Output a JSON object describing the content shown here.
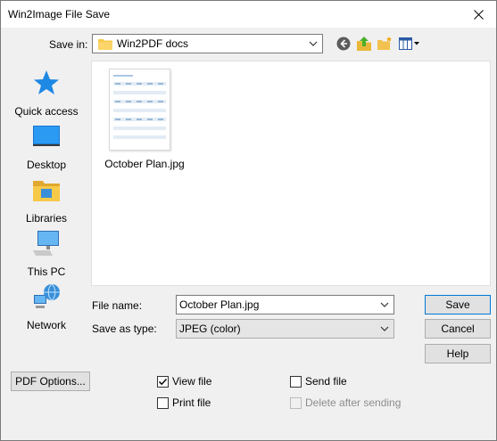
{
  "window": {
    "title": "Win2Image File Save"
  },
  "save_in": {
    "label": "Save in:",
    "value": "Win2PDF docs"
  },
  "toolbar": {
    "back_icon": "back-arrow-icon",
    "up_icon": "up-folder-icon",
    "new_folder_icon": "new-folder-icon",
    "view_menu_icon": "view-menu-icon"
  },
  "places": [
    {
      "label": "Quick access",
      "icon": "star-icon"
    },
    {
      "label": "Desktop",
      "icon": "desktop-icon"
    },
    {
      "label": "Libraries",
      "icon": "libraries-icon"
    },
    {
      "label": "This PC",
      "icon": "computer-icon"
    },
    {
      "label": "Network",
      "icon": "network-icon"
    }
  ],
  "files": [
    {
      "name": "October Plan.jpg"
    }
  ],
  "form": {
    "file_name_label": "File name:",
    "file_name_value": "October Plan.jpg",
    "save_type_label": "Save as type:",
    "save_type_value": "JPEG (color)"
  },
  "buttons": {
    "save": "Save",
    "cancel": "Cancel",
    "help": "Help",
    "pdf_options": "PDF Options..."
  },
  "options": {
    "view_file": {
      "label": "View file",
      "checked": true
    },
    "print_file": {
      "label": "Print file",
      "checked": false
    },
    "send_file": {
      "label": "Send file",
      "checked": false
    },
    "delete_after": {
      "label": "Delete after sending",
      "checked": false,
      "disabled": true
    }
  },
  "colors": {
    "accent": "#0078d7",
    "folder": "#f7c948",
    "dialog_bg": "#f0f0f0"
  }
}
